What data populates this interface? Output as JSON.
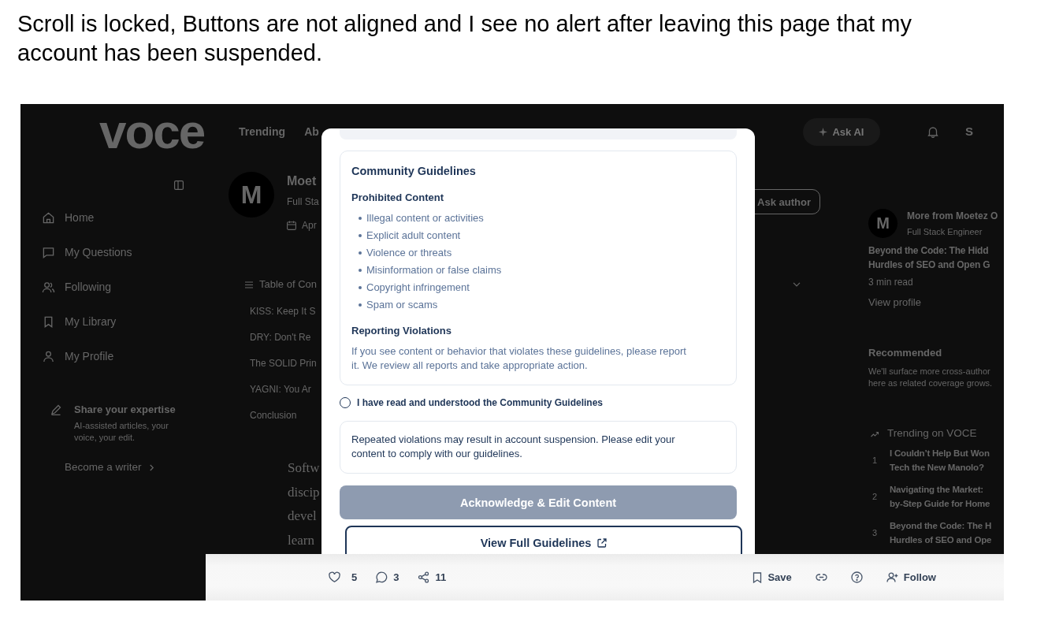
{
  "caption": "Scroll is locked, Buttons are not aligned and I see no alert after leaving this page that my account has been suspended.",
  "page": {
    "header": {
      "logo": "voce",
      "nav_links": [
        "Trending",
        "Ab"
      ],
      "ask_button": "Ask AI",
      "user_initial": "S"
    },
    "sidebar": {
      "items": [
        "Home",
        "My Questions",
        "Following",
        "My Library",
        "My Profile"
      ],
      "promo": {
        "title": "Share your expertise",
        "text": "AI-assisted articles, your voice, your edit.",
        "link": "Become a writer"
      }
    },
    "author": {
      "initial": "M",
      "name": "Moet",
      "role": "Full Sta",
      "date": "Apr",
      "ask_button": "Ask author"
    },
    "toc": {
      "title": "Table of Con",
      "items": [
        "KISS: Keep It S",
        "DRY: Don't Re",
        "The SOLID Prin",
        "YAGNI: You Ar",
        "Conclusion"
      ]
    },
    "article_lines": [
      "Softw",
      "discip",
      "devel",
      "learn"
    ],
    "more_from_author": {
      "initial": "M",
      "title": "More from Moetez O",
      "role": "Full Stack Engineer",
      "article": "Beyond the Code: The Hidd\nHurdles of SEO and Open G",
      "read_time": "3 min read",
      "link": "View profile"
    },
    "recommended": {
      "title": "Recommended",
      "text": "We'll surface more cross-author\nhere as related coverage grows."
    },
    "trending": {
      "title": "Trending on VOCE",
      "items": [
        {
          "number": "1",
          "title": "I Couldn’t Help But Won\nTech the New Manolo?"
        },
        {
          "number": "2",
          "title": "Navigating the Market:\nby-Step Guide for Home"
        },
        {
          "number": "3",
          "title": "Beyond the Code: The H\nHurdles of SEO and Ope"
        }
      ]
    }
  },
  "modal": {
    "guidelines": {
      "title": "Community Guidelines",
      "sections": [
        {
          "kind": "list",
          "heading": "Prohibited Content",
          "items": [
            "Illegal content or activities",
            "Explicit adult content",
            "Violence or threats",
            "Misinformation or false claims",
            "Copyright infringement",
            "Spam or scams"
          ]
        },
        {
          "kind": "paragraph",
          "heading": "Reporting Violations",
          "text": "If you see content or behavior that violates these guidelines, please report it. We review all reports and take appropriate action."
        }
      ]
    },
    "checkbox": {
      "label": "I have read and understood the Community Guidelines",
      "checked": false
    },
    "notice": "Repeated violations may result in account suspension. Please edit your content to comply with our guidelines.",
    "buttons": [
      {
        "kind": "primary",
        "label": "Acknowledge & Edit Content",
        "disabled": true
      },
      {
        "kind": "outline",
        "label": "View Full Guidelines"
      }
    ]
  },
  "action_bar": {
    "stats": [
      {
        "kind": "likes",
        "count": "5"
      },
      {
        "kind": "comments",
        "count": "3"
      },
      {
        "kind": "shares",
        "count": "11"
      }
    ],
    "actions": [
      {
        "kind": "save",
        "label": "Save"
      },
      {
        "kind": "link"
      },
      {
        "kind": "help"
      },
      {
        "kind": "follow",
        "label": "Follow"
      }
    ]
  }
}
